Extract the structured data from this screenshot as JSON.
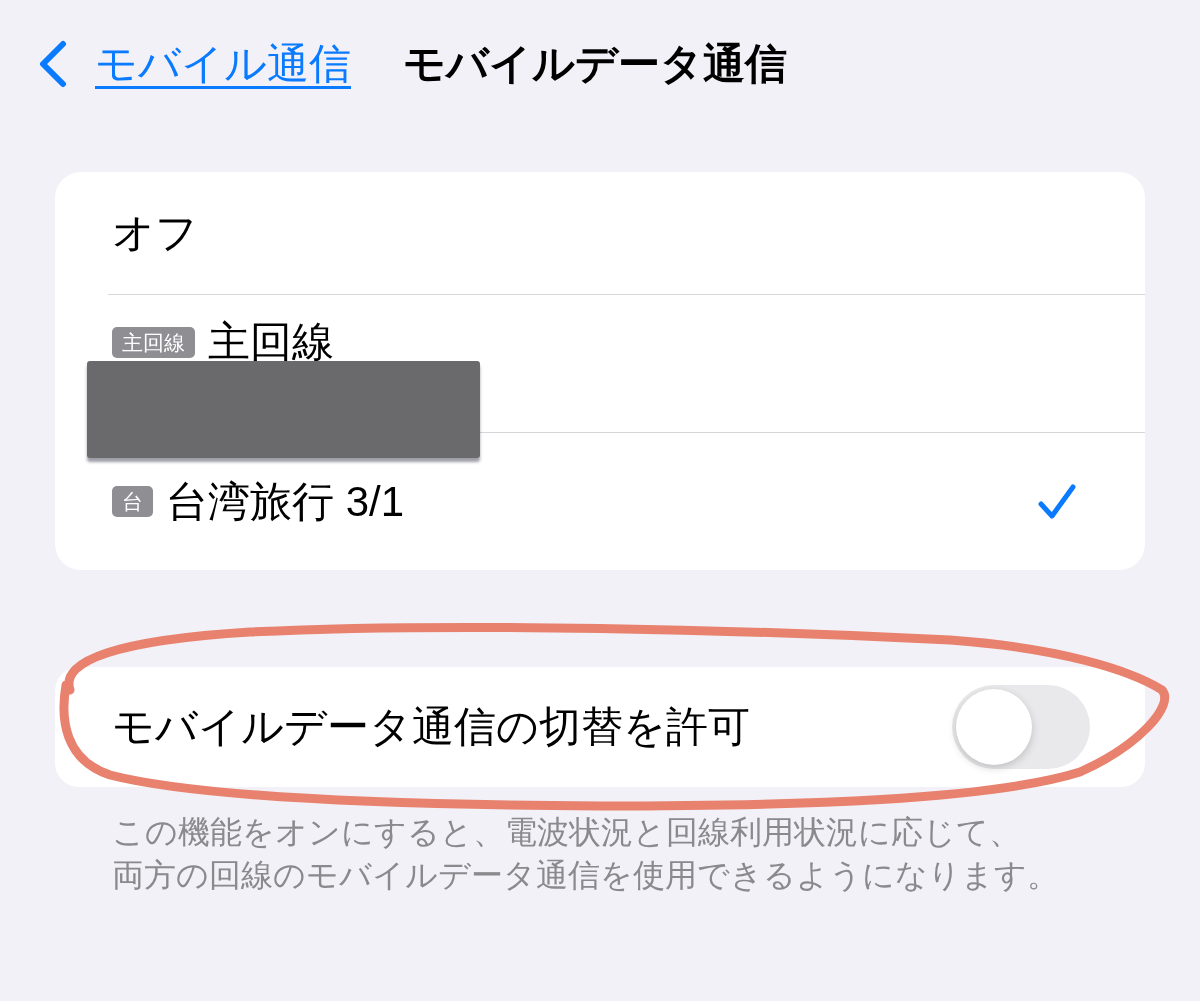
{
  "nav": {
    "back_label": "モバイル通信",
    "title": "モバイルデータ通信"
  },
  "sim_options": [
    {
      "label": "オフ",
      "selected": false,
      "redacted": false
    },
    {
      "badge": "主回線",
      "label": "主回線",
      "selected": false,
      "redacted": true
    },
    {
      "badge": "台",
      "label": "台湾旅行 3/1",
      "selected": true,
      "redacted": false
    }
  ],
  "switching": {
    "label": "モバイルデータ通信の切替を許可",
    "on": false
  },
  "footer": "この機能をオンにすると、電波状況と回線利用状況に応じて、両方の回線のモバイルデータ通信を使用できるようになります。"
}
